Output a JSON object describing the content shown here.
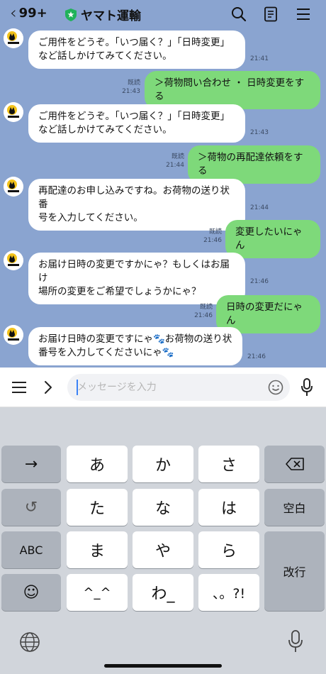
{
  "header": {
    "back_count": "99+",
    "title": "ヤマト運輸"
  },
  "messages": [
    {
      "side": "in",
      "text": "ご用件をどうぞ。「いつ届く？」「日時変更」\nなど話しかけてみてください。",
      "time": "21:41"
    },
    {
      "side": "out",
      "text": "＞荷物問い合わせ ・ 日時変更をする",
      "read": "既読",
      "time": "21:43"
    },
    {
      "side": "in",
      "text": "ご用件をどうぞ。「いつ届く？」「日時変更」\nなど話しかけてみてください。",
      "time": "21:43"
    },
    {
      "side": "out",
      "text": "＞荷物の再配達依頼をする",
      "read": "既読",
      "time": "21:44"
    },
    {
      "side": "in",
      "text": "再配達のお申し込みですね。お荷物の送り状番\n号を入力してください。",
      "time": "21:44"
    },
    {
      "side": "out",
      "text": "変更したいにゃん",
      "read": "既読",
      "time": "21:46"
    },
    {
      "side": "in",
      "text": "お届け日時の変更ですかにゃ？もしくはお届け\n場所の変更をご希望でしょうかにゃ？",
      "time": "21:46"
    },
    {
      "side": "out",
      "text": "日時の変更だにゃん",
      "read": "既読",
      "time": "21:46"
    },
    {
      "side": "in",
      "text": "お届け日時の変更ですにゃ🐾お荷物の送り状\n番号を入力してくださいにゃ🐾",
      "time": "21:46"
    }
  ],
  "input": {
    "placeholder": "メッセージを入力"
  },
  "keyboard": {
    "row1": [
      "→",
      "あ",
      "か",
      "さ",
      "⌫"
    ],
    "row2": [
      "↺",
      "た",
      "な",
      "は",
      "空白"
    ],
    "row3": [
      "ABC",
      "ま",
      "や",
      "ら",
      "改行"
    ],
    "row4": [
      "☺",
      "^_^",
      "わ_",
      "、。?!"
    ]
  },
  "colors": {
    "chat_bg": "#8aa4d0",
    "bubble_out": "#7ed97a",
    "bubble_in": "#ffffff",
    "brand_green": "#20b25a"
  }
}
